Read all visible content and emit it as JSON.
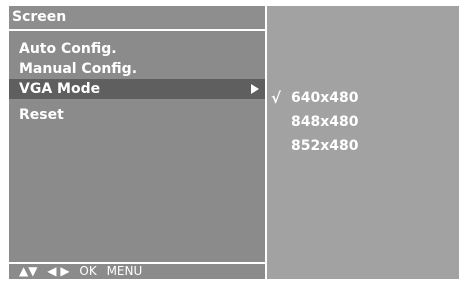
{
  "screen": {
    "title": "Screen",
    "menu": [
      {
        "label": "Auto Config."
      },
      {
        "label": "Manual Config."
      },
      {
        "label": "VGA Mode",
        "selected": true
      },
      {
        "label": "Reset"
      }
    ],
    "nav": {
      "updown": "▲▼",
      "leftright": "◀ ▶",
      "ok": "OK",
      "menu": "MENU"
    }
  },
  "submenu": {
    "check_mark": "√",
    "options": [
      {
        "label": "640x480",
        "checked": true
      },
      {
        "label": "848x480",
        "checked": false
      },
      {
        "label": "852x480",
        "checked": false
      }
    ]
  },
  "colors": {
    "left_panel": "#8b8b8b",
    "right_panel": "#a2a2a2",
    "selected_row": "#5f5f5f",
    "text": "#ffffff"
  }
}
